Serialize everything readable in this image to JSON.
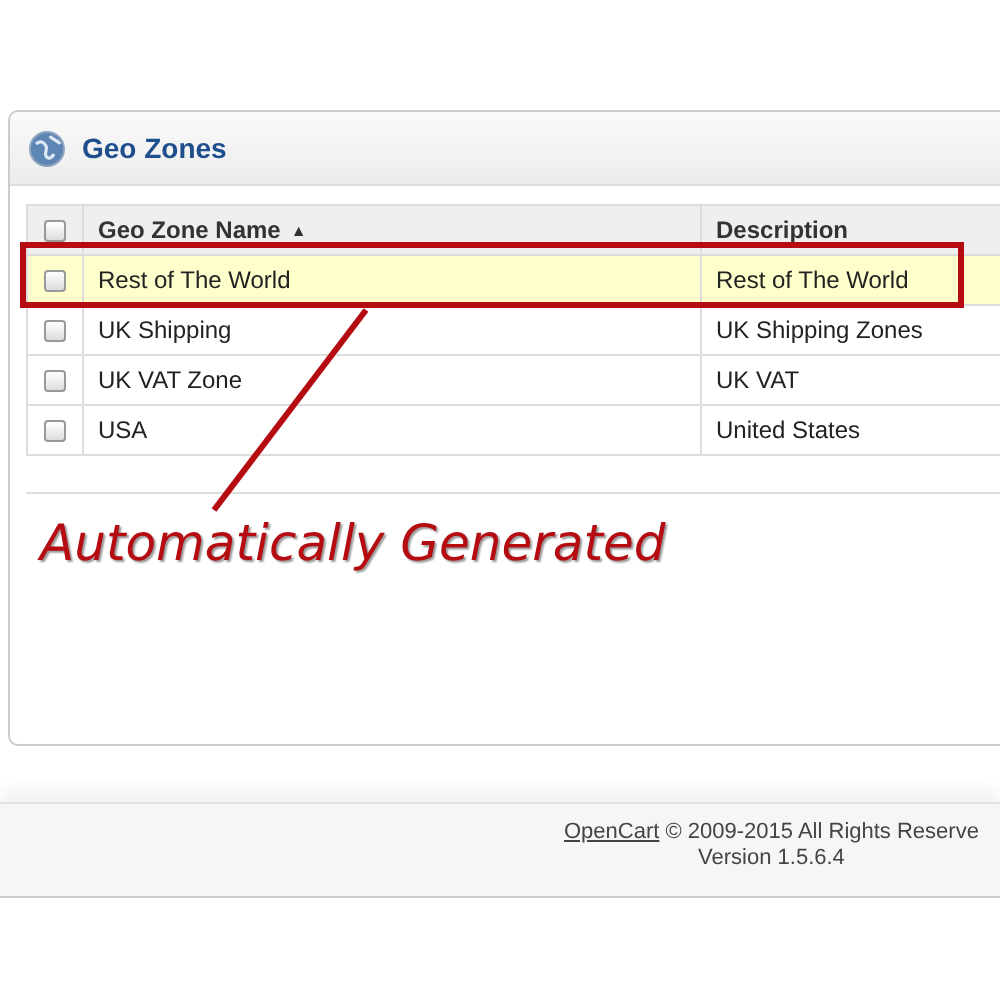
{
  "panel": {
    "title": "Geo Zones"
  },
  "table": {
    "columns": [
      {
        "label": "Geo Zone Name",
        "sort_indicator": "▲"
      },
      {
        "label": "Description"
      }
    ],
    "rows": [
      {
        "name": "Rest of The World",
        "description": "Rest of The World",
        "checked": false,
        "highlighted": true
      },
      {
        "name": "UK Shipping",
        "description": "UK Shipping Zones",
        "checked": false,
        "highlighted": false
      },
      {
        "name": "UK VAT Zone",
        "description": "UK VAT",
        "checked": false,
        "highlighted": false
      },
      {
        "name": "USA",
        "description": "United States",
        "checked": false,
        "highlighted": false
      }
    ],
    "header_checked": false
  },
  "annotation": {
    "text": "Automatically Generated"
  },
  "footer": {
    "link": "OpenCart",
    "text": "© 2009-2015 All Rights Reserve",
    "version": "Version 1.5.6.4"
  }
}
